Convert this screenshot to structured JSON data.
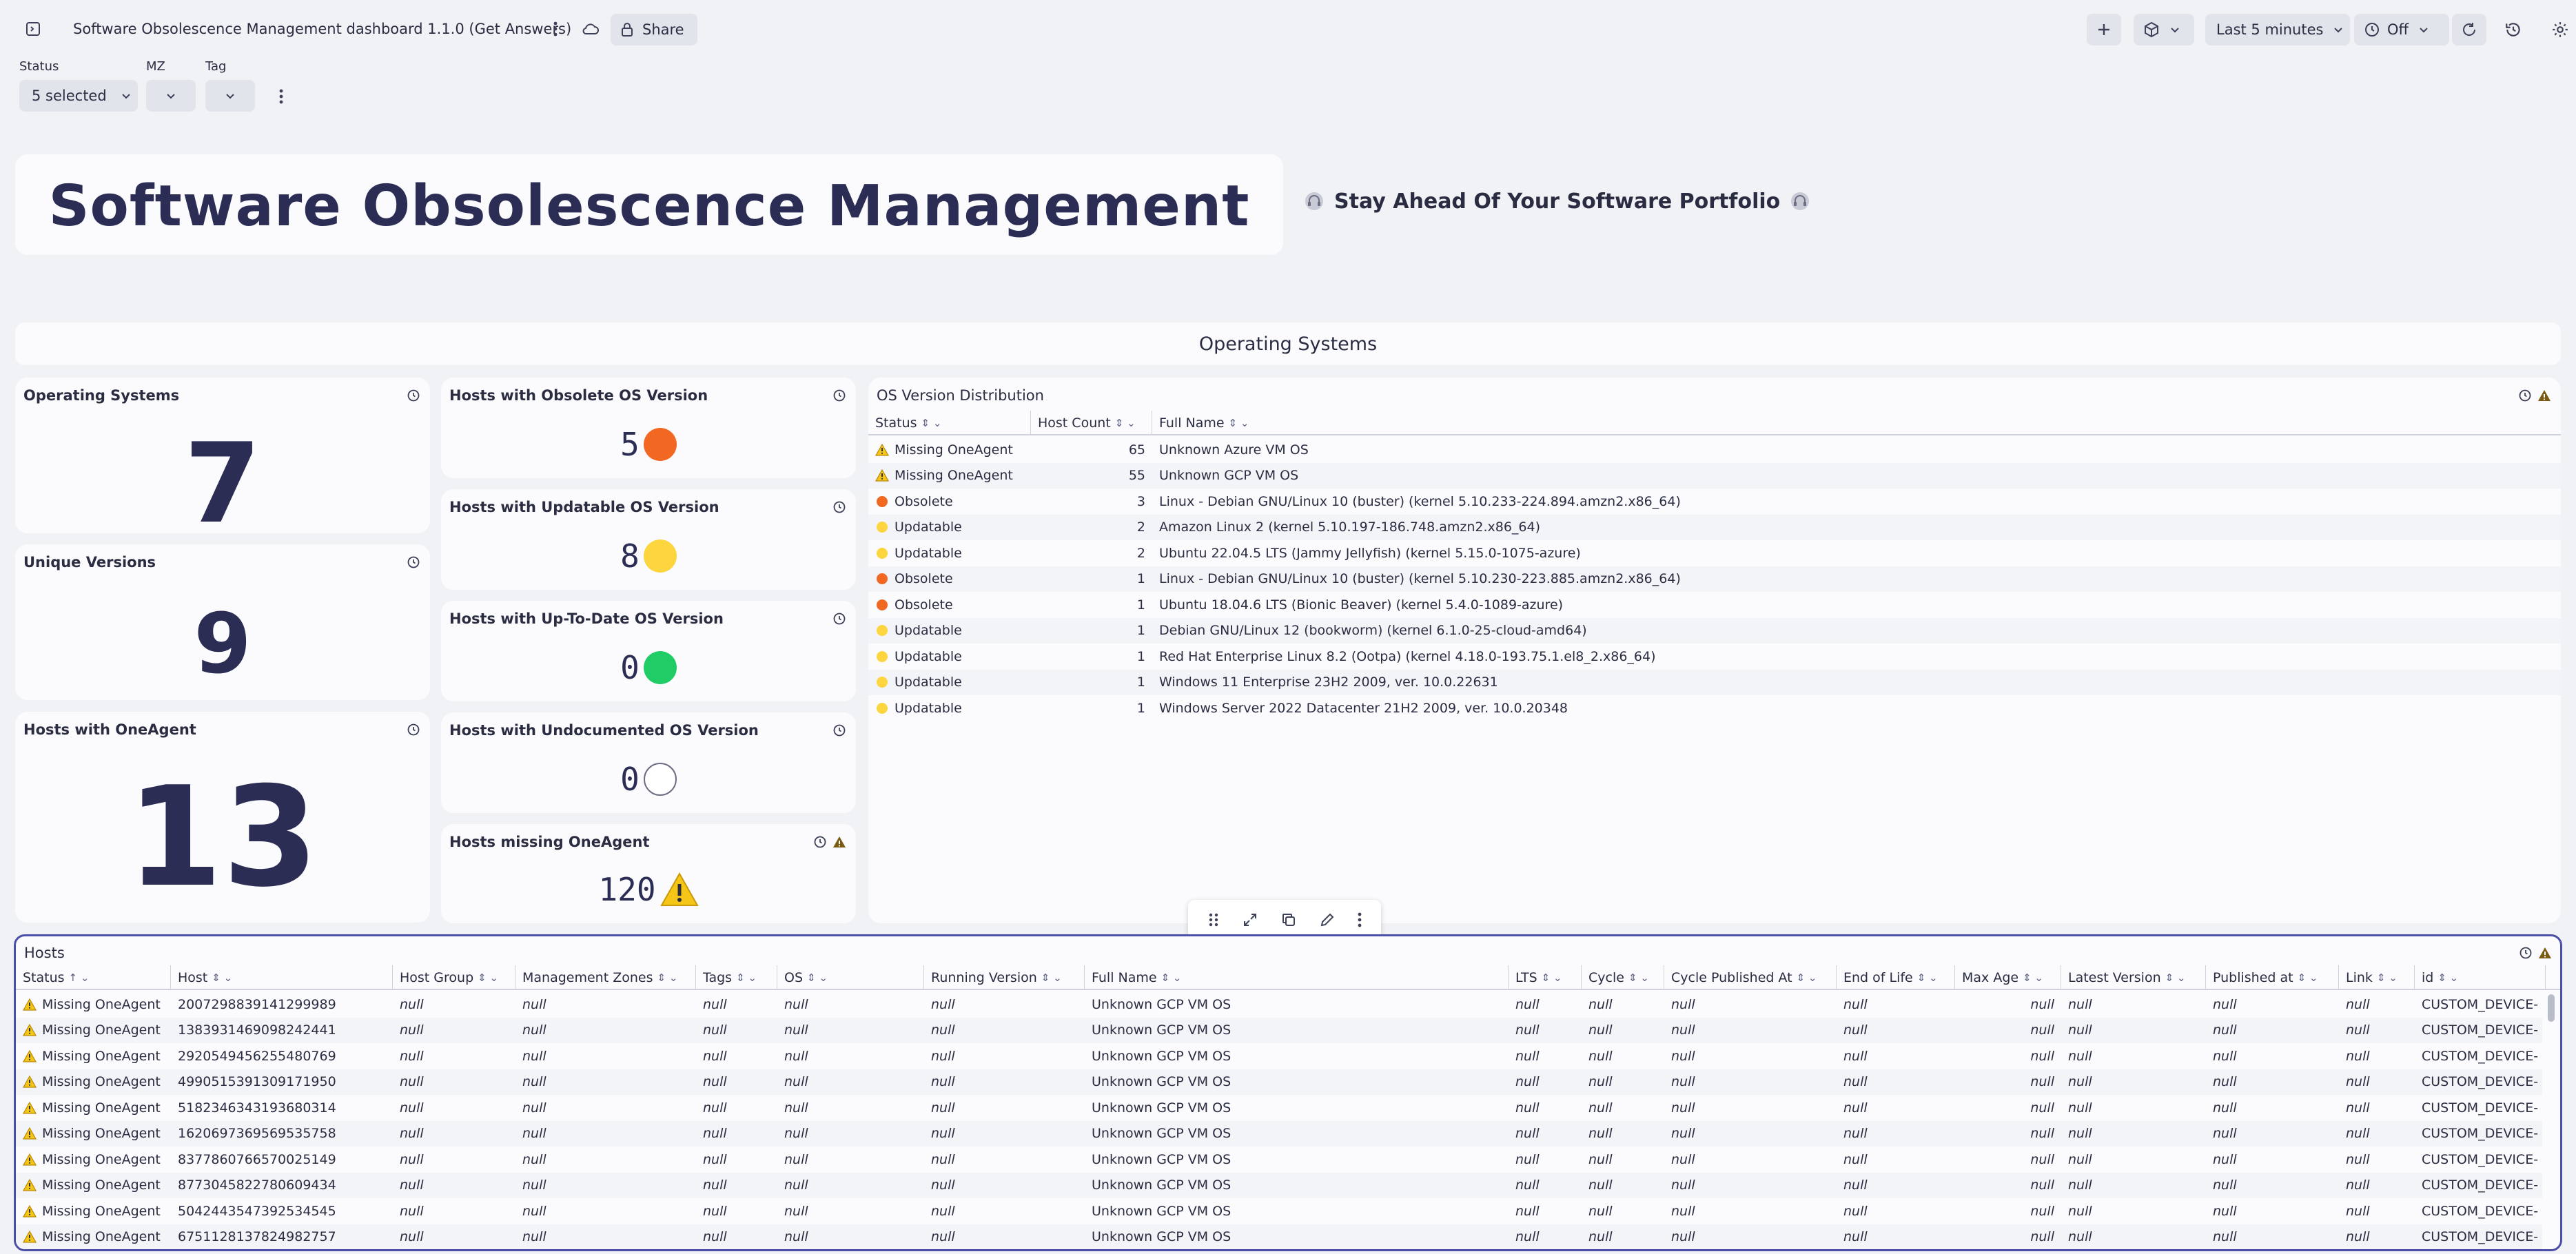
{
  "topbar": {
    "title": "Software Obsolescence Management dashboard 1.1.0 (Get Answers)",
    "share_label": "Share",
    "timeframe_label": "Last 5 minutes",
    "refresh_label": "Off"
  },
  "filters": [
    {
      "label": "Status",
      "value": "5 selected"
    },
    {
      "label": "MZ",
      "value": ""
    },
    {
      "label": "Tag",
      "value": ""
    }
  ],
  "header": {
    "title": "Software Obsolescence Management",
    "tagline": "Stay Ahead Of Your Software Portfolio"
  },
  "section": {
    "title": "Operating Systems"
  },
  "tiles": {
    "os_count": {
      "title": "Operating Systems",
      "value": "7"
    },
    "unique_versions": {
      "title": "Unique Versions",
      "value": "9"
    },
    "with_agent": {
      "title": "Hosts with OneAgent",
      "value": "13"
    },
    "obsolete": {
      "title": "Hosts with Obsolete OS Version",
      "value": "5"
    },
    "updatable": {
      "title": "Hosts with Updatable OS Version",
      "value": "8"
    },
    "uptodate": {
      "title": "Hosts with Up-To-Date OS Version",
      "value": "0"
    },
    "undocumented": {
      "title": "Hosts with Undocumented OS Version",
      "value": "0"
    },
    "missing": {
      "title": "Hosts missing OneAgent",
      "value": "120"
    }
  },
  "colors": {
    "obsolete": "#f26722",
    "updatable": "#fcd53f",
    "uptodate": "#1fcc66",
    "warning": "#f5c518",
    "accent": "#3b3f9c"
  },
  "os_table": {
    "title": "OS Version Distribution",
    "columns": [
      "Status",
      "Host Count",
      "Full Name"
    ],
    "rows": [
      {
        "status": "Missing OneAgent",
        "icon": "warning",
        "count": "65",
        "name": "Unknown Azure VM OS"
      },
      {
        "status": "Missing OneAgent",
        "icon": "warning",
        "count": "55",
        "name": "Unknown GCP VM OS"
      },
      {
        "status": "Obsolete",
        "icon": "obsolete",
        "count": "3",
        "name": "Linux - Debian GNU/Linux 10 (buster) (kernel 5.10.233-224.894.amzn2.x86_64)"
      },
      {
        "status": "Updatable",
        "icon": "updatable",
        "count": "2",
        "name": "Amazon Linux 2 (kernel 5.10.197-186.748.amzn2.x86_64)"
      },
      {
        "status": "Updatable",
        "icon": "updatable",
        "count": "2",
        "name": "Ubuntu 22.04.5 LTS (Jammy Jellyfish) (kernel 5.15.0-1075-azure)"
      },
      {
        "status": "Obsolete",
        "icon": "obsolete",
        "count": "1",
        "name": "Linux - Debian GNU/Linux 10 (buster) (kernel 5.10.230-223.885.amzn2.x86_64)"
      },
      {
        "status": "Obsolete",
        "icon": "obsolete",
        "count": "1",
        "name": "Ubuntu 18.04.6 LTS (Bionic Beaver) (kernel 5.4.0-1089-azure)"
      },
      {
        "status": "Updatable",
        "icon": "updatable",
        "count": "1",
        "name": "Debian GNU/Linux 12 (bookworm) (kernel 6.1.0-25-cloud-amd64)"
      },
      {
        "status": "Updatable",
        "icon": "updatable",
        "count": "1",
        "name": "Red Hat Enterprise Linux 8.2 (Ootpa) (kernel 4.18.0-193.75.1.el8_2.x86_64)"
      },
      {
        "status": "Updatable",
        "icon": "updatable",
        "count": "1",
        "name": "Windows 11 Enterprise 23H2 2009, ver. 10.0.22631"
      },
      {
        "status": "Updatable",
        "icon": "updatable",
        "count": "1",
        "name": "Windows Server 2022 Datacenter 21H2 2009, ver. 10.0.20348"
      }
    ]
  },
  "hosts_table": {
    "title": "Hosts",
    "columns": [
      "Status",
      "Host",
      "Host Group",
      "Management Zones",
      "Tags",
      "OS",
      "Running Version",
      "Full Name",
      "LTS",
      "Cycle",
      "Cycle Published At",
      "End of Life",
      "Max Age",
      "Latest Version",
      "Published at",
      "Link",
      "id"
    ],
    "null_text": "null",
    "rows": [
      {
        "status": "Missing OneAgent",
        "host": "2007298839141299989",
        "full_name": "Unknown GCP VM OS",
        "id": "CUSTOM_DEVICE-"
      },
      {
        "status": "Missing OneAgent",
        "host": "1383931469098242441",
        "full_name": "Unknown GCP VM OS",
        "id": "CUSTOM_DEVICE-"
      },
      {
        "status": "Missing OneAgent",
        "host": "2920549456255480769",
        "full_name": "Unknown GCP VM OS",
        "id": "CUSTOM_DEVICE-"
      },
      {
        "status": "Missing OneAgent",
        "host": "4990515391309171950",
        "full_name": "Unknown GCP VM OS",
        "id": "CUSTOM_DEVICE-"
      },
      {
        "status": "Missing OneAgent",
        "host": "5182346343193680314",
        "full_name": "Unknown GCP VM OS",
        "id": "CUSTOM_DEVICE-"
      },
      {
        "status": "Missing OneAgent",
        "host": "1620697369569535758",
        "full_name": "Unknown GCP VM OS",
        "id": "CUSTOM_DEVICE-"
      },
      {
        "status": "Missing OneAgent",
        "host": "8377860766570025149",
        "full_name": "Unknown GCP VM OS",
        "id": "CUSTOM_DEVICE-"
      },
      {
        "status": "Missing OneAgent",
        "host": "8773045822780609434",
        "full_name": "Unknown GCP VM OS",
        "id": "CUSTOM_DEVICE-"
      },
      {
        "status": "Missing OneAgent",
        "host": "5042443547392534545",
        "full_name": "Unknown GCP VM OS",
        "id": "CUSTOM_DEVICE-"
      },
      {
        "status": "Missing OneAgent",
        "host": "6751128137824982757",
        "full_name": "Unknown GCP VM OS",
        "id": "CUSTOM_DEVICE-"
      }
    ]
  }
}
